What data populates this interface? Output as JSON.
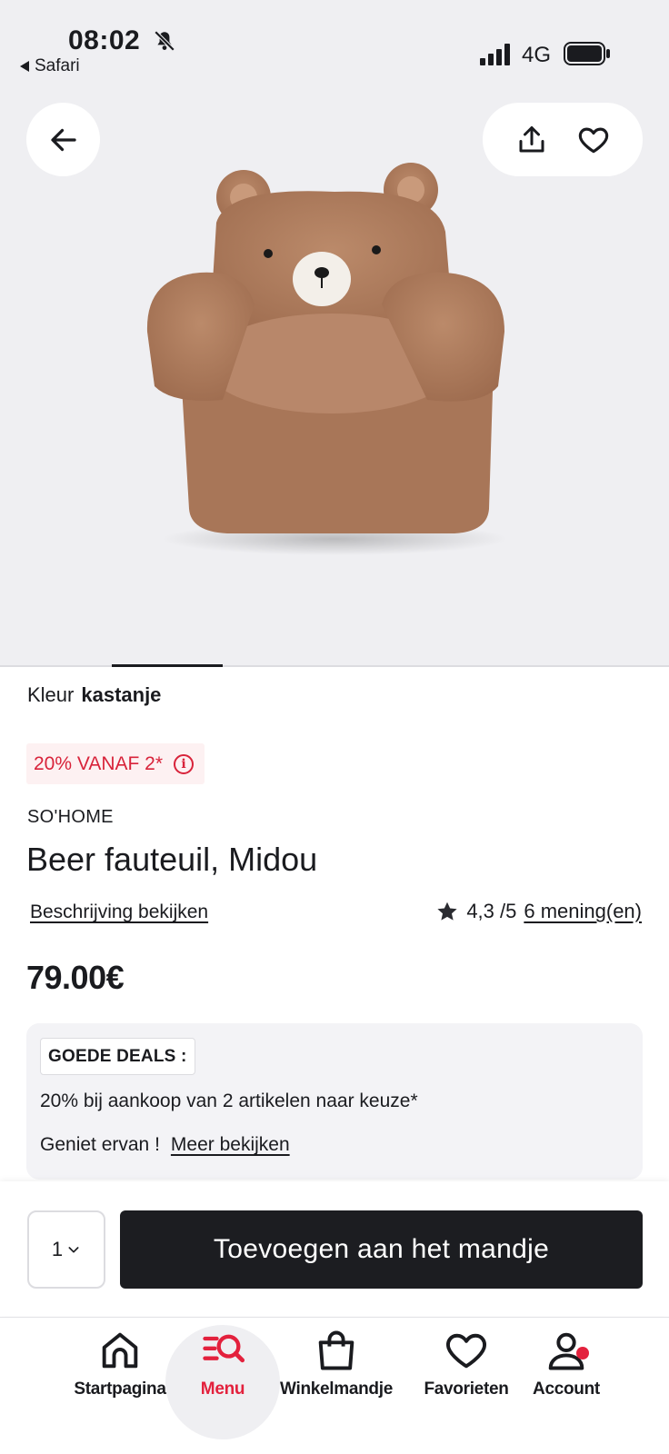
{
  "status_bar": {
    "time": "08:02",
    "back_app": "Safari",
    "network": "4G"
  },
  "product": {
    "color_label": "Kleur",
    "color_value": "kastanje",
    "promo_badge": "20% VANAF 2*",
    "brand": "SO'HOME",
    "title": "Beer fauteuil, Midou",
    "description_link": "Beschrijving bekijken",
    "rating_value": "4,3 /5",
    "reviews_link": "6 mening(en)",
    "price": "79.00€"
  },
  "deals": {
    "tag": "GOEDE DEALS :",
    "text": "20% bij aankoop van 2 artikelen naar keuze*",
    "enjoy": "Geniet ervan !",
    "more_link": "Meer bekijken"
  },
  "cart": {
    "quantity": "1",
    "add_button": "Toevoegen aan het mandje"
  },
  "nav": {
    "home": "Startpagina",
    "menu": "Menu",
    "cart": "Winkelmandje",
    "favorites": "Favorieten",
    "account": "Account"
  },
  "colors": {
    "accent": "#e3213d",
    "promo_bg": "#fdf1f2",
    "button_dark": "#1c1d21",
    "hero_bg": "#efeff2",
    "bear_fabric": "#b07d5e"
  },
  "icons": [
    "bell-slash-icon",
    "back-triangle-icon",
    "signal-icon",
    "battery-icon",
    "arrow-left-icon",
    "share-icon",
    "heart-icon",
    "info-icon",
    "star-icon",
    "chevron-down-icon",
    "home-icon",
    "menu-search-icon",
    "bag-icon",
    "heart-outline-icon",
    "user-icon"
  ]
}
